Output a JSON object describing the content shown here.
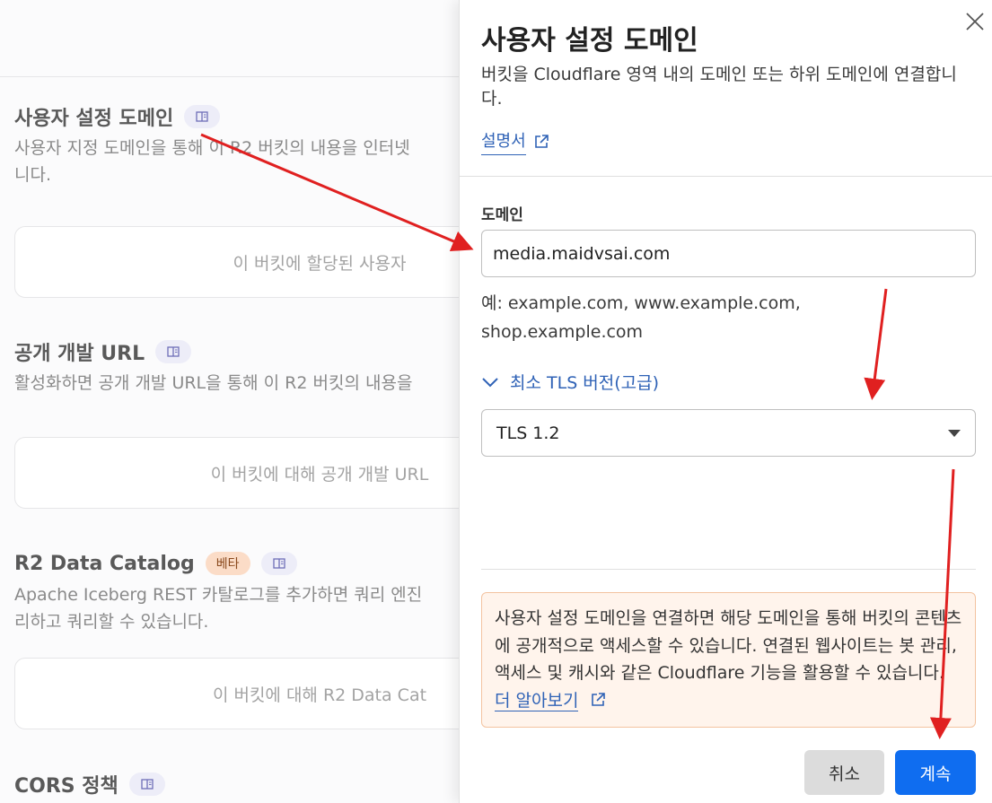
{
  "background": {
    "sections": [
      {
        "title": "사용자 설정 도메인",
        "description": "사용자 지정 도메인을 통해 이 R2 버킷의 내용을 인터넷\n니다.",
        "card_text": "이 버킷에 할당된 사용자"
      },
      {
        "title": "공개 개발 URL",
        "description": "활성화하면 공개 개발 URL을 통해 이 R2 버킷의 내용을",
        "card_text": "이 버킷에 대해 공개 개발 URL"
      },
      {
        "title": "R2 Data Catalog",
        "badge": "베타",
        "description": "Apache Iceberg REST 카탈로그를 추가하면 쿼리 엔진\n리하고 쿼리할 수 있습니다.",
        "card_text": "이 버킷에 대해 R2 Data Cat"
      },
      {
        "title": "CORS 정책"
      }
    ]
  },
  "panel": {
    "title": "사용자 설정 도메인",
    "description": "버킷을 Cloudflare 영역 내의 도메인 또는 하위 도메인에 연결합니다.",
    "docs_link": "설명서",
    "domain_label": "도메인",
    "domain_value": "media.maidvsai.com",
    "hint": "예: example.com, www.example.com, shop.example.com",
    "tls_toggle": "최소 TLS 버전(고급)",
    "tls_value": "TLS 1.2",
    "notice_text": "사용자 설정 도메인을 연결하면 해당 도메인을 통해 버킷의 콘텐츠에 공개적으로 액세스할 수 있습니다. 연결된 웹사이트는 봇 관리, 액세스 및 캐시와 같은 Cloudflare 기능을 활용할 수 있습니다.",
    "notice_link": "더 알아보기",
    "cancel_label": "취소",
    "continue_label": "계속"
  },
  "colors": {
    "accent": "#0f6df0",
    "link": "#2f62b6",
    "annotation_arrow": "#e02020",
    "notice_bg": "#fff4ec",
    "notice_border": "#f3c3a0"
  },
  "icons": [
    "book-icon",
    "close-icon",
    "external-link-icon",
    "chevron-down-icon",
    "caret-down-icon"
  ]
}
